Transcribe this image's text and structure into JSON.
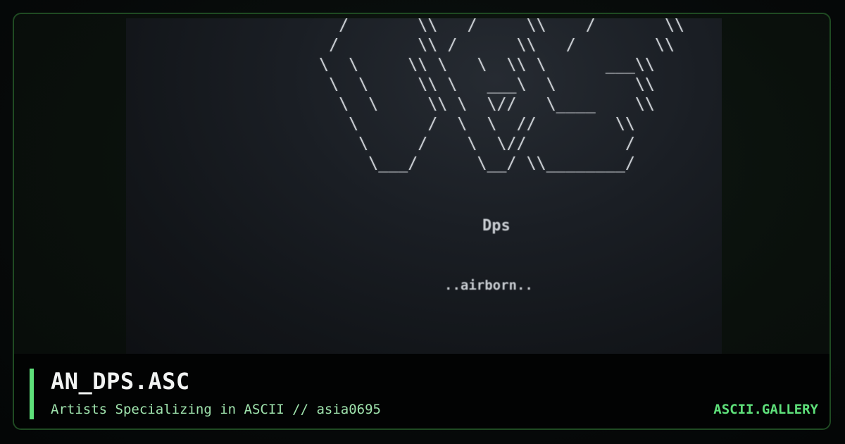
{
  "artwork": {
    "ascii_lines": [
      "    /       \\\\   /     \\\\    /       \\\\",
      "   /        \\\\ /      \\\\   /        \\\\",
      "  \\  \\     \\\\ \\   \\  \\\\ \\      ___\\\\",
      "   \\  \\     \\\\ \\   ___\\  \\        \\\\",
      "    \\  \\     \\\\ \\  \\//   \\____    \\\\",
      "     \\       /  \\  \\  //        \\\\",
      "      \\     /    \\  \\//          /",
      "       \\___/      \\__/ \\\\________/"
    ],
    "signature": "Dps",
    "tagline": "..airborn.."
  },
  "info": {
    "title": "AN_DPS.ASC",
    "subtitle": "Artists Specializing in ASCII // asia0695",
    "brand": "ASCII.GALLERY"
  },
  "colors": {
    "accent": "#5ee07a",
    "subtitle": "#9fe3ad",
    "title": "#f2f4f3",
    "frame_border": "#1f4a22",
    "art_text": "#c9cdd2"
  }
}
